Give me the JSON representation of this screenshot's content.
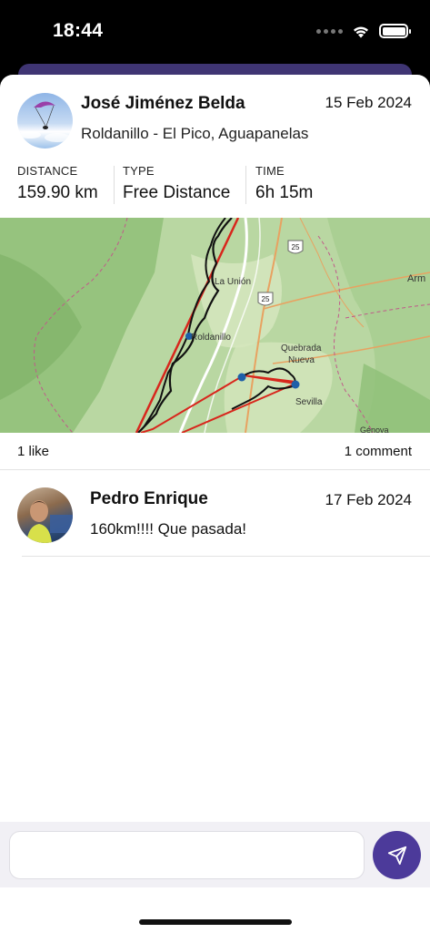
{
  "status_bar": {
    "time": "18:44",
    "icons": [
      "signal-icon",
      "wifi-icon",
      "battery-icon"
    ]
  },
  "flight": {
    "pilot_name": "José Jiménez Belda",
    "date": "15 Feb 2024",
    "place": "Roldanillo - El Pico, Aguapanelas",
    "avatar": "paraglider-avatar"
  },
  "stats": [
    {
      "label": "DISTANCE",
      "value": "159.90 km"
    },
    {
      "label": "TYPE",
      "value": "Free Distance"
    },
    {
      "label": "TIME",
      "value": "6h 15m"
    }
  ],
  "map": {
    "labels": {
      "la_union": "La Unión",
      "roldanillo": "Roldanillo",
      "quebrada": "Quebrada",
      "nueva": "Nueva",
      "sevilla": "Sevilla",
      "arm": "Arm",
      "genova": "Génova"
    },
    "highway_shields": [
      "25",
      "25"
    ],
    "colors": {
      "terrain": "#b6d5a0",
      "track": "#111111",
      "route": "#d8261c",
      "waypoint": "#1e5fa8",
      "road": "#e8a261",
      "border": "#c05a8a",
      "river": "#ffffff"
    }
  },
  "social": {
    "likes": "1 like",
    "comments": "1 comment"
  },
  "comment": {
    "author": "Pedro Enrique",
    "date": "17 Feb 2024",
    "text": "160km!!!! Que pasada!",
    "avatar": "pedro-avatar"
  },
  "composer": {
    "placeholder": "",
    "send_icon": "send-icon"
  },
  "colors": {
    "accent": "#4c3a9a",
    "sheet_back": "#3f3573"
  }
}
